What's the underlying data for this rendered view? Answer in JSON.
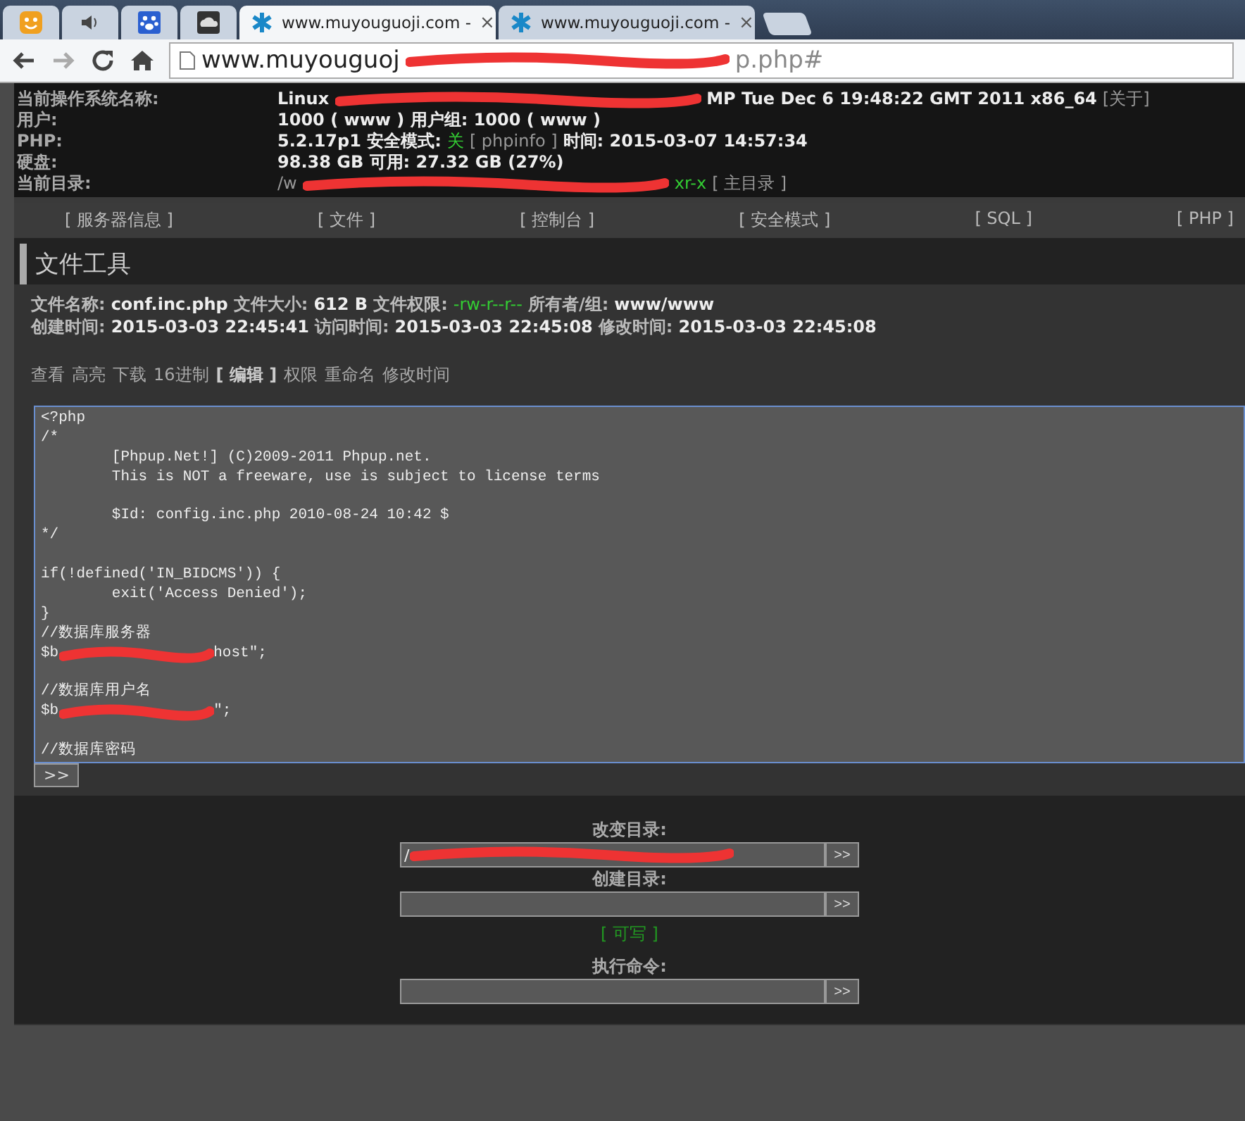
{
  "browser": {
    "tabs": [
      {
        "kind": "pinned",
        "selected": false
      },
      {
        "kind": "pinned",
        "selected": false
      },
      {
        "kind": "pinned",
        "selected": false
      },
      {
        "kind": "pinned",
        "selected": false
      },
      {
        "kind": "page",
        "title": "www.muyouguoji.com -",
        "close": "×",
        "selected": true
      },
      {
        "kind": "page",
        "title": "www.muyouguoji.com -",
        "close": "×",
        "selected": false
      }
    ],
    "address": {
      "before": "www.muyouguoj",
      "after": "p.php#",
      "redacted": true
    }
  },
  "info": [
    {
      "label": "当前操作系统名称:",
      "parts": [
        {
          "kind": "text",
          "text": "Linux"
        },
        {
          "kind": "redaction"
        },
        {
          "kind": "text",
          "text": "MP Tue Dec 6 19:48:22 GMT 2011 x86_64"
        },
        {
          "kind": "link",
          "text": "[关于]"
        }
      ]
    },
    {
      "label": "用户:",
      "parts": [
        {
          "kind": "text",
          "text": "1000 ( www ) 用户组: 1000 ( www )"
        }
      ]
    },
    {
      "label": "PHP:",
      "parts": [
        {
          "kind": "text",
          "text": "5.2.17p1 安全模式:"
        },
        {
          "kind": "ok",
          "text": "关"
        },
        {
          "kind": "link",
          "text": "[ phpinfo ]"
        },
        {
          "kind": "text",
          "text": "时间: 2015-03-07 14:57:34"
        }
      ]
    },
    {
      "label": "硬盘:",
      "parts": [
        {
          "kind": "text",
          "text": "98.38 GB 可用: 27.32 GB (27%)"
        }
      ]
    },
    {
      "label": "当前目录:",
      "parts": [
        {
          "kind": "link",
          "text": "/w"
        },
        {
          "kind": "redaction"
        },
        {
          "kind": "ok",
          "text": "xr-x"
        },
        {
          "kind": "link",
          "text": "[ 主目录 ]"
        }
      ]
    }
  ],
  "nav": [
    "[ 服务器信息 ]",
    "[ 文件 ]",
    "[ 控制台 ]",
    "[ 安全模式 ]",
    "[ SQL ]",
    "[ PHP ]"
  ],
  "section_title": "文件工具",
  "file_info": [
    [
      {
        "kind": "label",
        "text": "文件名称:"
      },
      {
        "kind": "text",
        "text": "conf.inc.php"
      },
      {
        "kind": "label",
        "text": "文件大小:"
      },
      {
        "kind": "text",
        "text": "612 B"
      },
      {
        "kind": "label",
        "text": "文件权限:"
      },
      {
        "kind": "ok",
        "text": "-rw-r--r--"
      },
      {
        "kind": "label",
        "text": "所有者/组:"
      },
      {
        "kind": "text",
        "text": "www/www"
      }
    ],
    [
      {
        "kind": "label",
        "text": "创建时间:"
      },
      {
        "kind": "text",
        "text": "2015-03-03 22:45:41"
      },
      {
        "kind": "label",
        "text": "访问时间:"
      },
      {
        "kind": "text",
        "text": "2015-03-03 22:45:08"
      },
      {
        "kind": "label",
        "text": "修改时间:"
      },
      {
        "kind": "text",
        "text": "2015-03-03 22:45:08"
      }
    ]
  ],
  "actions": [
    {
      "label": "查看",
      "selected": false
    },
    {
      "label": "高亮",
      "selected": false
    },
    {
      "label": "下载",
      "selected": false
    },
    {
      "label": "16进制",
      "selected": false
    },
    {
      "label": "[ 编辑 ]",
      "selected": true
    },
    {
      "label": "权限",
      "selected": false
    },
    {
      "label": "重命名",
      "selected": false
    },
    {
      "label": "修改时间",
      "selected": false
    }
  ],
  "editor": {
    "lines": [
      {
        "kind": "text",
        "text": "<?php"
      },
      {
        "kind": "text",
        "text": "/*"
      },
      {
        "kind": "text",
        "text": "        [Phpup.Net!] (C)2009-2011 Phpup.net."
      },
      {
        "kind": "text",
        "text": "        This is NOT a freeware, use is subject to license terms"
      },
      {
        "kind": "blank"
      },
      {
        "kind": "text",
        "text": "        $Id: config.inc.php 2010-08-24 10:42 $"
      },
      {
        "kind": "text",
        "text": "*/"
      },
      {
        "kind": "blank"
      },
      {
        "kind": "text",
        "text": "if(!defined('IN_BIDCMS')) {"
      },
      {
        "kind": "text",
        "text": "        exit('Access Denied');"
      },
      {
        "kind": "text",
        "text": "}"
      },
      {
        "kind": "text",
        "text": "//数据库服务器"
      },
      {
        "kind": "redacted",
        "before": "$b",
        "after": "host\";"
      },
      {
        "kind": "blank"
      },
      {
        "kind": "text",
        "text": "//数据库用户名"
      },
      {
        "kind": "redacted",
        "before": "$b",
        "after": "\";"
      },
      {
        "kind": "blank"
      },
      {
        "kind": "text",
        "text": "//数据库密码"
      }
    ],
    "button": ">>"
  },
  "forms": [
    {
      "kind": "field",
      "label": "改变目录:",
      "value": "/",
      "redacted": true,
      "button": ">>"
    },
    {
      "kind": "field",
      "label": "创建目录:",
      "button": ">>"
    },
    {
      "kind": "status",
      "text": "[ 可写 ]"
    },
    {
      "kind": "field",
      "label": "执行命令:",
      "button": ">>"
    }
  ]
}
